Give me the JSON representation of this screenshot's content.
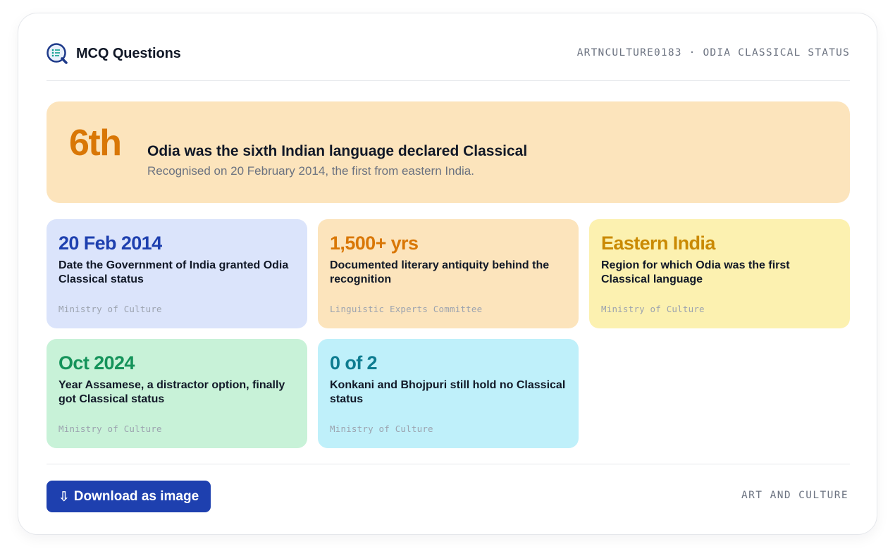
{
  "header": {
    "brand_icon": "mcq-logo-icon",
    "title": "MCQ Questions",
    "meta": "ARTNCULTURE0183 · ODIA CLASSICAL STATUS"
  },
  "hero": {
    "big": "6th",
    "title": "Odia was the sixth Indian language declared Classical",
    "subtitle": "Recognised on 20 February 2014, the first from eastern India.",
    "color": "#d97706",
    "background": "#fce4bc"
  },
  "stats": [
    {
      "value": "20 Feb 2014",
      "desc": "Date the Government of India granted Odia Classical status",
      "source": "Ministry of Culture",
      "color": "#1e40af",
      "background": "#dbe4fb"
    },
    {
      "value": "1,500+ yrs",
      "desc": "Documented literary antiquity behind the recognition",
      "source": "Linguistic Experts Committee",
      "color": "#d97706",
      "background": "#fce4bc"
    },
    {
      "value": "Eastern India",
      "desc": "Region for which Odia was the first Classical language",
      "source": "Ministry of Culture",
      "color": "#ca8a04",
      "background": "#fcf1b0"
    },
    {
      "value": "Oct 2024",
      "desc": "Year Assamese, a distractor option, finally got Classical status",
      "source": "Ministry of Culture",
      "color": "#15935a",
      "background": "#c8f2d8"
    },
    {
      "value": "0 of 2",
      "desc": "Konkani and Bhojpuri still hold no Classical status",
      "source": "Ministry of Culture",
      "color": "#0e7c90",
      "background": "#bff0fa"
    }
  ],
  "footer": {
    "download_icon": "download-arrow-icon",
    "download_label": "Download as image",
    "tag": "ART AND CULTURE",
    "button_color": "#1e40af"
  }
}
